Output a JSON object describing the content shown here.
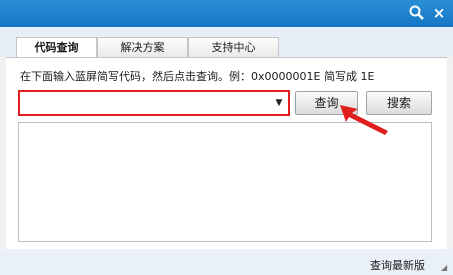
{
  "window": {
    "search_icon": "magnifier-icon",
    "close_label": "×"
  },
  "tabs": [
    {
      "label": "代码查询",
      "active": true
    },
    {
      "label": "解决方案",
      "active": false
    },
    {
      "label": "支持中心",
      "active": false
    }
  ],
  "main": {
    "instruction": "在下面输入蓝屏简写代码，然后点击查询。例：0x0000001E 简写成 1E",
    "code_input": {
      "value": "",
      "placeholder": ""
    },
    "query_button": "查询",
    "search_button": "搜索",
    "highlight_color": "#e01e1e"
  },
  "status": {
    "latest_link": "查询最新版"
  }
}
